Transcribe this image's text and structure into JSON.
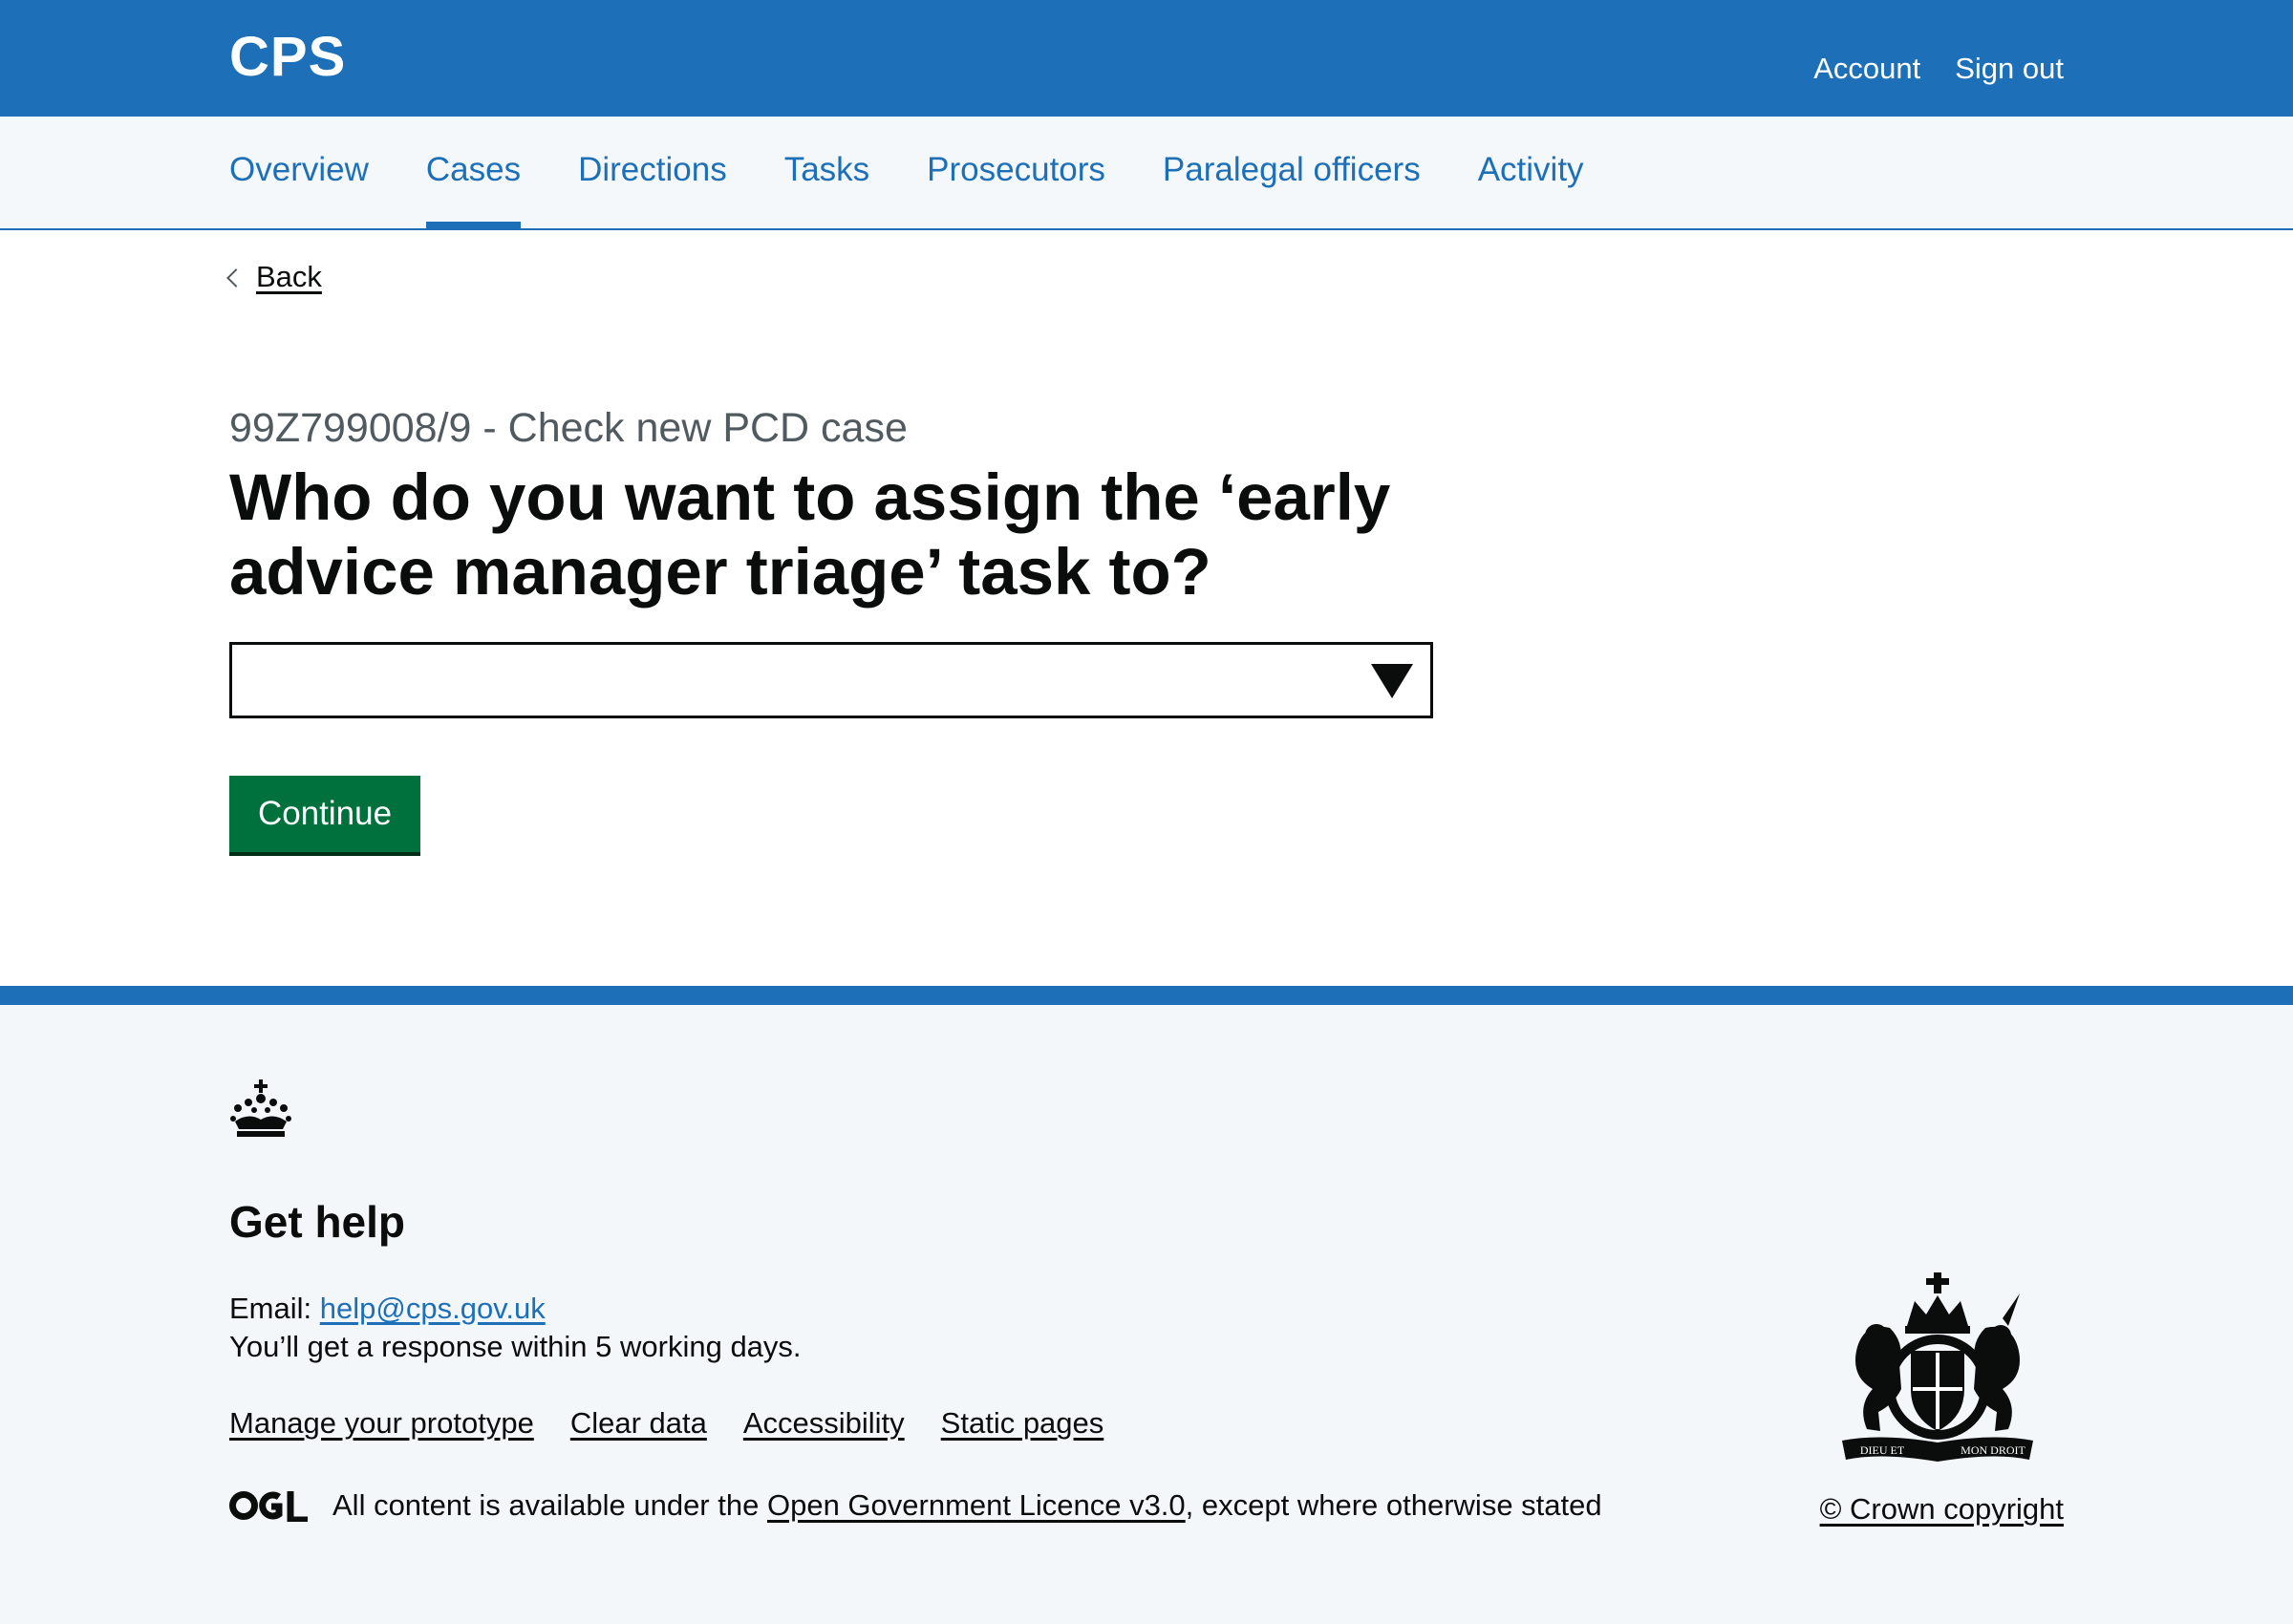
{
  "header": {
    "logo": "CPS",
    "links": [
      "Account",
      "Sign out"
    ]
  },
  "nav": {
    "items": [
      "Overview",
      "Cases",
      "Directions",
      "Tasks",
      "Prosecutors",
      "Paralegal officers",
      "Activity"
    ],
    "active": "Cases"
  },
  "back": {
    "label": "Back"
  },
  "form": {
    "caption": "99Z799008/9 - Check new PCD case",
    "heading": "Who do you want to assign the ‘early advice manager triage’ task to?",
    "select_value": "",
    "button_label": "Continue"
  },
  "footer": {
    "help_title": "Get help",
    "email_label": "Email:",
    "email": "help@cps.gov.uk",
    "response": "You’ll get a response within 5 working days.",
    "links": [
      "Manage your prototype",
      "Clear data",
      "Accessibility",
      "Static pages"
    ],
    "licence_prefix": "All content is available under the",
    "licence_link": "Open Government Licence v3.0",
    "licence_suffix": ", except where otherwise stated",
    "copyright": "© Crown copyright",
    "coat_motto_left": "DIEU ET",
    "coat_motto_right": "MON DROIT"
  },
  "colors": {
    "brand_blue": "#1d70b8",
    "button_green": "#00703c",
    "text": "#0b0c0c",
    "secondary_text": "#505a5f",
    "footer_bg": "#f3f7fa"
  },
  "icons": [
    "chevron-left-icon",
    "dropdown-arrow-icon",
    "crown-icon",
    "ogl-logo-icon",
    "royal-coat-of-arms-icon"
  ]
}
